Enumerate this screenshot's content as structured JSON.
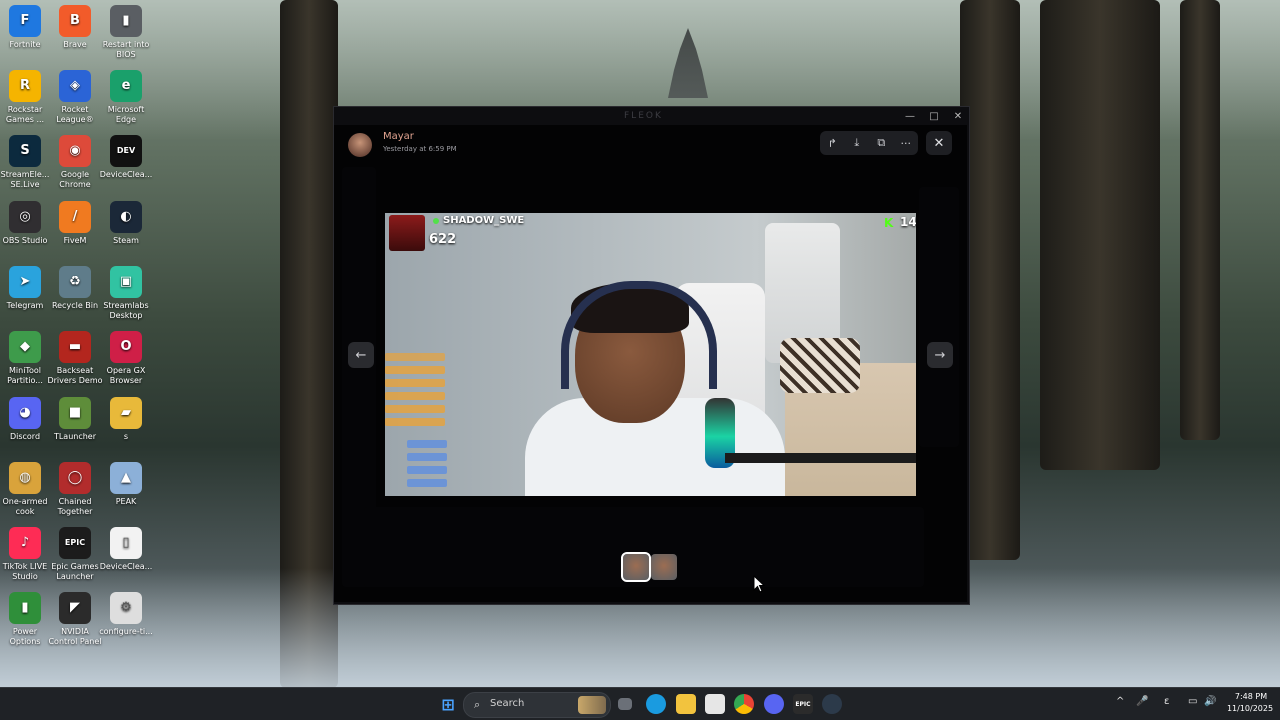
{
  "desktop": {
    "icons": [
      {
        "label": "Fortnite",
        "glyph": "F",
        "color": "#1f78e0"
      },
      {
        "label": "Brave",
        "glyph": "B",
        "color": "#f25b2a"
      },
      {
        "label": "Restart into BIOS",
        "glyph": "▮",
        "color": "#5a5e63"
      },
      {
        "label": "Rockstar Games ...",
        "glyph": "R",
        "color": "#f5b400"
      },
      {
        "label": "Rocket League®",
        "glyph": "◈",
        "color": "#2b64d6"
      },
      {
        "label": "Microsoft Edge",
        "glyph": "e",
        "color": "#1aa06b"
      },
      {
        "label": "StreamEle... SE.Live",
        "glyph": "S",
        "color": "#0c2a3e"
      },
      {
        "label": "Google Chrome",
        "glyph": "◉",
        "color": "#dd4a3a"
      },
      {
        "label": "DeviceClea...",
        "glyph": "DEV",
        "color": "#111111"
      },
      {
        "label": "OBS Studio",
        "glyph": "◎",
        "color": "#302e31"
      },
      {
        "label": "FiveM",
        "glyph": "/",
        "color": "#f07a20"
      },
      {
        "label": "Steam",
        "glyph": "◐",
        "color": "#1b2838"
      },
      {
        "label": "Telegram",
        "glyph": "➤",
        "color": "#2aa3dd"
      },
      {
        "label": "Recycle Bin",
        "glyph": "♻",
        "color": "#5f7c8a"
      },
      {
        "label": "Streamlabs Desktop",
        "glyph": "▣",
        "color": "#31c3a2"
      },
      {
        "label": "MiniTool Partitio...",
        "glyph": "◆",
        "color": "#3e9b4b"
      },
      {
        "label": "Backseat Drivers Demo",
        "glyph": "▬",
        "color": "#b3261e"
      },
      {
        "label": "Opera GX Browser",
        "glyph": "O",
        "color": "#cf1f47"
      },
      {
        "label": "Discord",
        "glyph": "◕",
        "color": "#5865f2"
      },
      {
        "label": "TLauncher",
        "glyph": "■",
        "color": "#5e8d3a"
      },
      {
        "label": "s",
        "glyph": "▰",
        "color": "#e8b93a"
      },
      {
        "label": "One-armed cook",
        "glyph": "◍",
        "color": "#d9a33b"
      },
      {
        "label": "Chained Together",
        "glyph": "◯",
        "color": "#b22c2c"
      },
      {
        "label": "PEAK",
        "glyph": "▲",
        "color": "#8cb0d8"
      },
      {
        "label": "TikTok LIVE Studio",
        "glyph": "♪",
        "color": "#fe2c55"
      },
      {
        "label": "Epic Games Launcher",
        "glyph": "EPIC",
        "color": "#1c1c1c"
      },
      {
        "label": "DeviceClea...",
        "glyph": "▯",
        "color": "#f2f2f2"
      },
      {
        "label": "Power Options",
        "glyph": "▮",
        "color": "#2f8f3a"
      },
      {
        "label": "NVIDIA Control Panel",
        "glyph": "◤",
        "color": "#2b2b2b"
      },
      {
        "label": "configure-ti...",
        "glyph": "⚙",
        "color": "#dedede"
      }
    ]
  },
  "viewer": {
    "author": "Mayar",
    "timestamp": "Yesterday at 6:59 PM",
    "toolbar": {
      "forward_icon": "↱",
      "download_icon": "⤓",
      "open_icon": "⧉",
      "more_icon": "···",
      "close_icon": "✕"
    },
    "prev_icon": "←",
    "next_icon": "→",
    "stream_overlay": {
      "streamer": "SHADOW_SWE",
      "count": "622",
      "kick_logo": "K",
      "kick_count": "14"
    }
  },
  "background_window": {
    "title": "FLEOK",
    "minimize": "—",
    "maximize": "□",
    "close": "✕"
  },
  "taskbar": {
    "start_icon": "⊞",
    "search_placeholder": "Search",
    "search_icon": "⌕",
    "clock_time": "7:48 PM",
    "clock_date": "11/10/2025",
    "tray_icons": [
      "^",
      "🎤",
      "ε",
      "▭",
      "🔊"
    ]
  },
  "colors": {
    "accent_author": "#e0a390",
    "kick_green": "#53fc18",
    "taskbar_bg": "#1f2226"
  }
}
